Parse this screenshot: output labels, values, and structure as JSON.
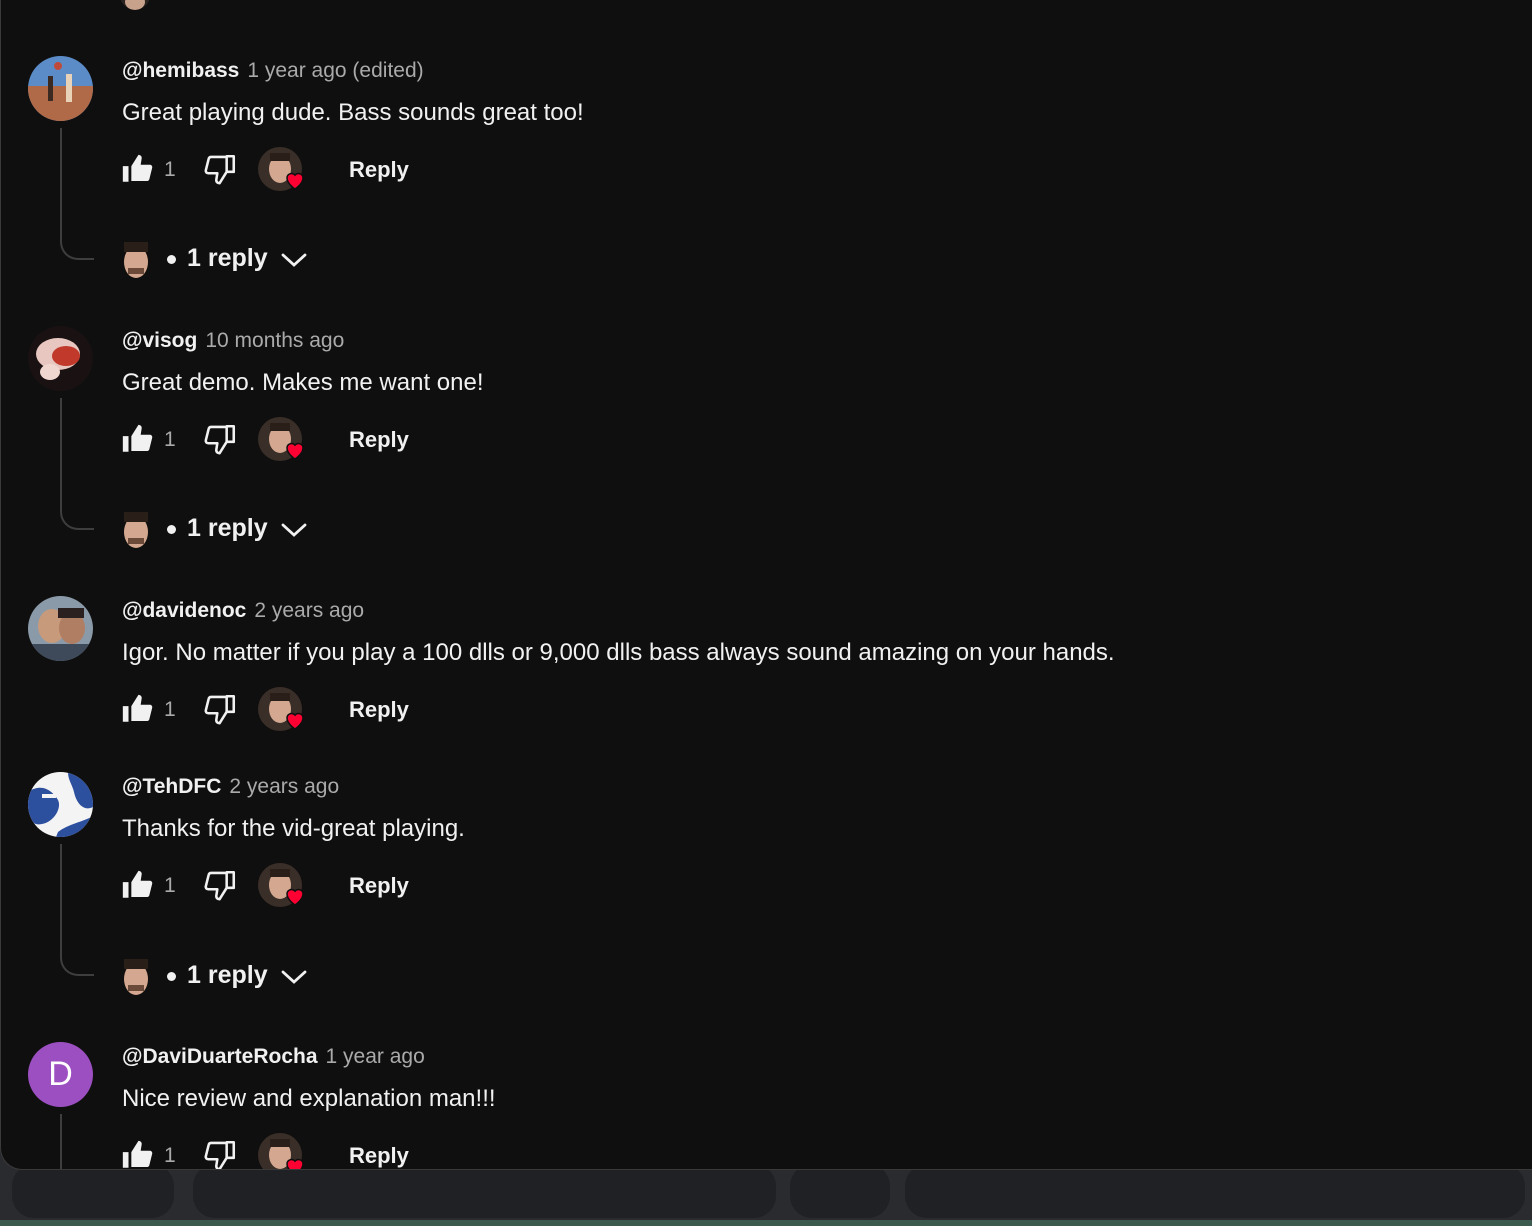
{
  "comments": [
    {
      "author": "@hemibass",
      "time": "1 year ago (edited)",
      "text": "Great playing dude. Bass sounds great too!",
      "likes": "1",
      "reply_label": "Reply",
      "replies_label": "1 reply",
      "avatar_color": "#4a7bb5"
    },
    {
      "author": "@visog",
      "time": "10 months ago",
      "text": "Great demo. Makes me want one!",
      "likes": "1",
      "reply_label": "Reply",
      "replies_label": "1 reply",
      "avatar_color": "#c0392b"
    },
    {
      "author": "@davidenoc",
      "time": "2 years ago",
      "text": "Igor. No matter if you play a 100 dlls or 9,000 dlls bass always sound amazing on your hands.",
      "likes": "1",
      "reply_label": "Reply",
      "avatar_color": "#6b7a8a"
    },
    {
      "author": "@TehDFC",
      "time": "2 years ago",
      "text": "Thanks for the vid-great playing.",
      "likes": "1",
      "reply_label": "Reply",
      "replies_label": "1 reply",
      "avatar_color": "#2c4f9e"
    },
    {
      "author": "@DaviDuarteRocha",
      "time": "1 year ago",
      "text": "Nice review and explanation man!!!",
      "likes": "1",
      "reply_label": "Reply",
      "avatar_letter": "D",
      "avatar_color": "#9c4fc0"
    }
  ],
  "colors": {
    "background": "#0f0f0f",
    "text_primary": "#f1f1f1",
    "text_secondary": "#aaaaaa",
    "heart": "#ff0033"
  },
  "icons": {
    "like": "thumbs-up-icon",
    "dislike": "thumbs-down-icon",
    "creator_heart": "heart-icon",
    "expand": "chevron-down-icon"
  }
}
